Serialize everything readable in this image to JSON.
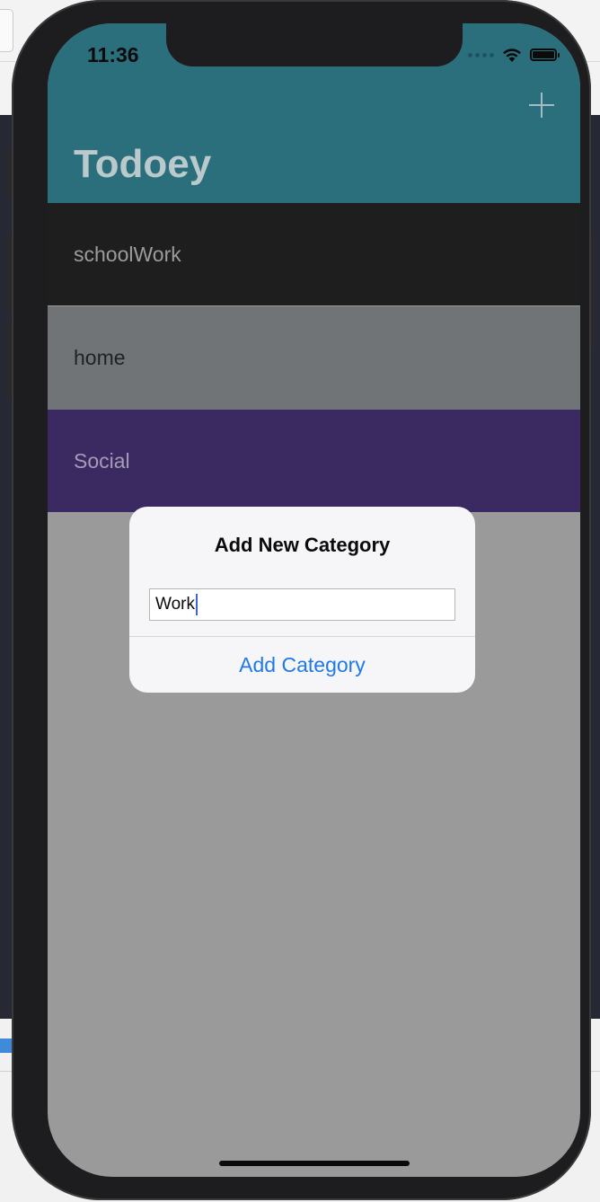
{
  "status_bar": {
    "time": "11:36"
  },
  "navbar": {
    "title": "Todoey",
    "add_icon": "plus-icon",
    "color": "#2c6f7c"
  },
  "categories": [
    {
      "name": "schoolWork",
      "color": "#1e1e1e"
    },
    {
      "name": "home",
      "color": "#707477"
    },
    {
      "name": "Social",
      "color": "#3b2a62"
    }
  ],
  "alert": {
    "title": "Add New Category",
    "text_field_value": "Work",
    "action_label": "Add Category",
    "action_color": "#1f7ae8"
  }
}
